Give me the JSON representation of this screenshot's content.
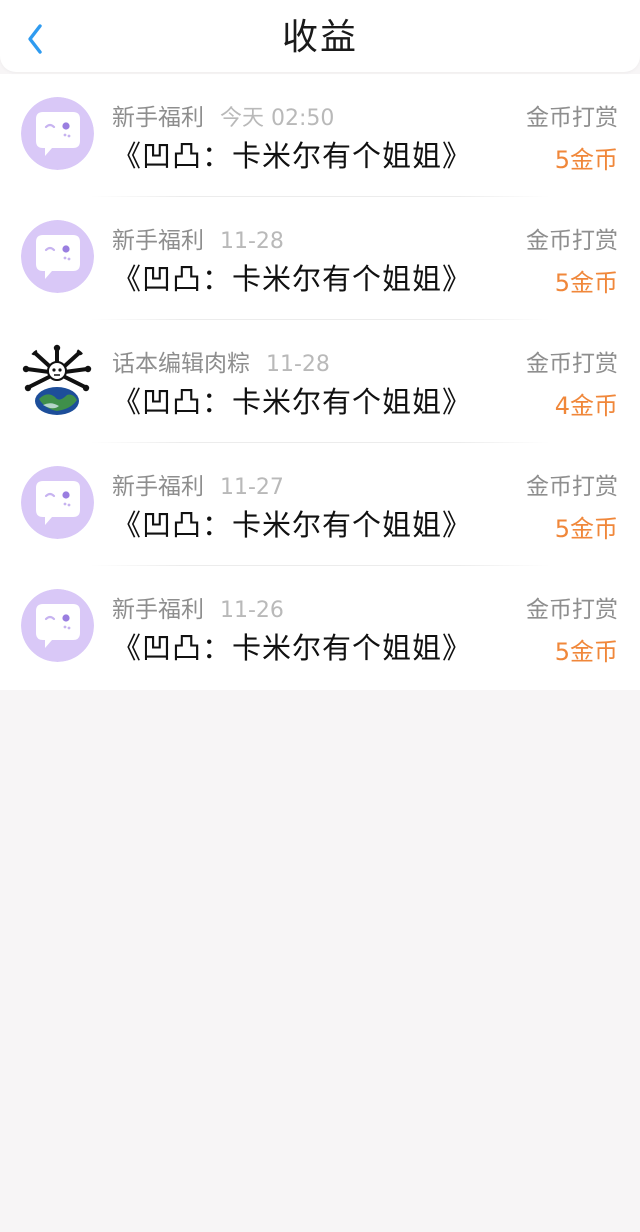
{
  "header": {
    "title": "收益",
    "back_icon": "chevron-left-icon",
    "accent_color": "#2f9bf0"
  },
  "records": [
    {
      "avatar": "purple-chat-bubble-avatar",
      "sender": "新手福利",
      "time": "今天 02:50",
      "title": "《凹凸：卡米尔有个姐姐》",
      "type": "金币打赏",
      "amount": "5金币"
    },
    {
      "avatar": "purple-chat-bubble-avatar",
      "sender": "新手福利",
      "time": "11-28",
      "title": "《凹凸：卡米尔有个姐姐》",
      "type": "金币打赏",
      "amount": "5金币"
    },
    {
      "avatar": "earth-skeleton-avatar",
      "sender": "话本编辑肉粽",
      "time": "11-28",
      "title": "《凹凸：卡米尔有个姐姐》",
      "type": "金币打赏",
      "amount": "4金币"
    },
    {
      "avatar": "purple-chat-bubble-avatar",
      "sender": "新手福利",
      "time": "11-27",
      "title": "《凹凸：卡米尔有个姐姐》",
      "type": "金币打赏",
      "amount": "5金币"
    },
    {
      "avatar": "purple-chat-bubble-avatar",
      "sender": "新手福利",
      "time": "11-26",
      "title": "《凹凸：卡米尔有个姐姐》",
      "type": "金币打赏",
      "amount": "5金币"
    }
  ],
  "colors": {
    "amount": "#f0873a",
    "avatar_purple": "#d9c8f7",
    "page_background": "#f7f5f6"
  }
}
